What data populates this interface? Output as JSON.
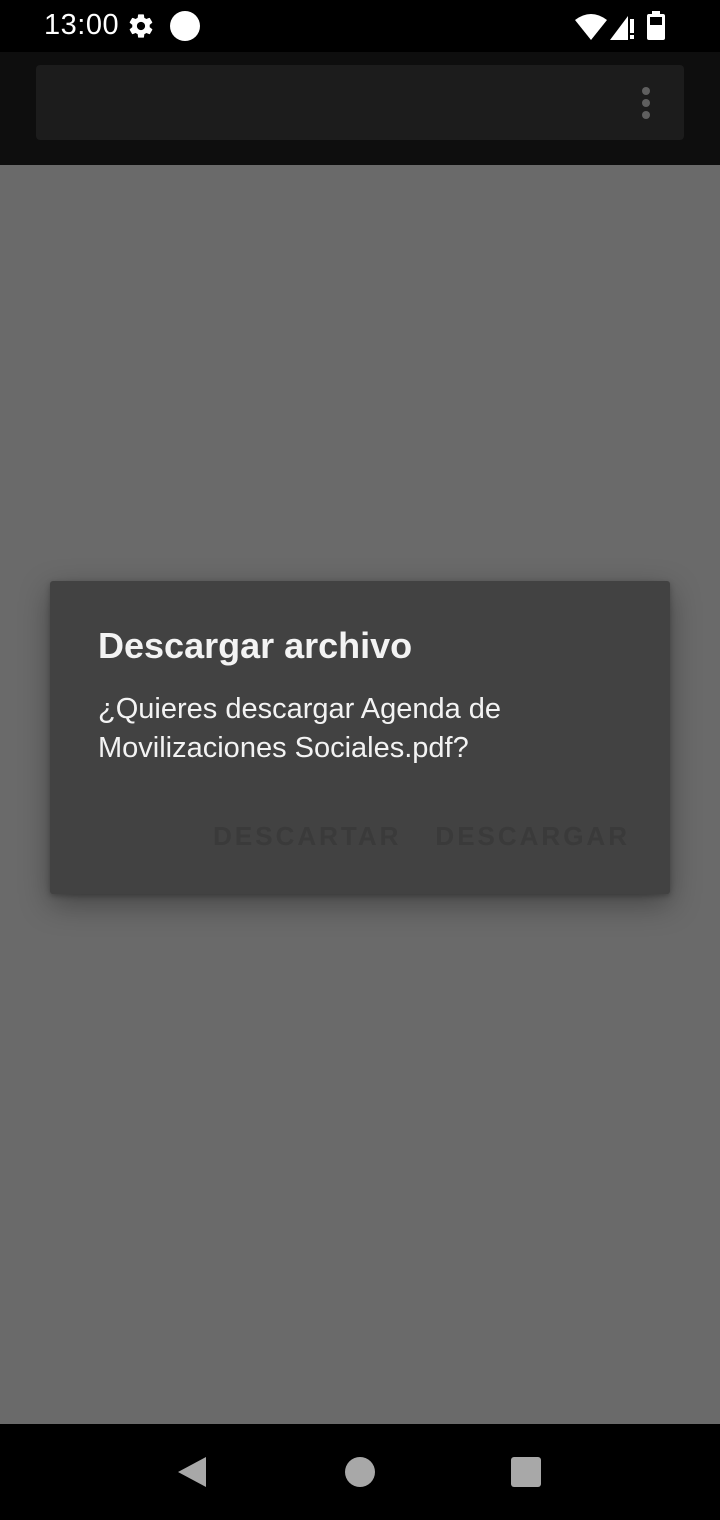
{
  "status_bar": {
    "time": "13:00",
    "icons": [
      "gear-icon",
      "notification-dot-icon",
      "wifi-icon",
      "signal-alert-icon",
      "battery-icon"
    ]
  },
  "app_bar": {
    "overflow_icon": "more-vert-icon"
  },
  "dialog": {
    "title": "Descargar archivo",
    "message": "¿Quieres descargar Agenda de Movilizaciones Sociales.pdf?",
    "dismiss_label": "DESCARTAR",
    "confirm_label": "DESCARGAR"
  },
  "nav_bar": {
    "icons": [
      "back-icon",
      "home-icon",
      "recents-icon"
    ]
  },
  "colors": {
    "scrim": "#6a6a6a",
    "dialog_bg": "#424242",
    "app_bar_bg": "#0e0e0e",
    "search_bg": "#1c1c1c",
    "button_text": "#3a3a3a"
  }
}
